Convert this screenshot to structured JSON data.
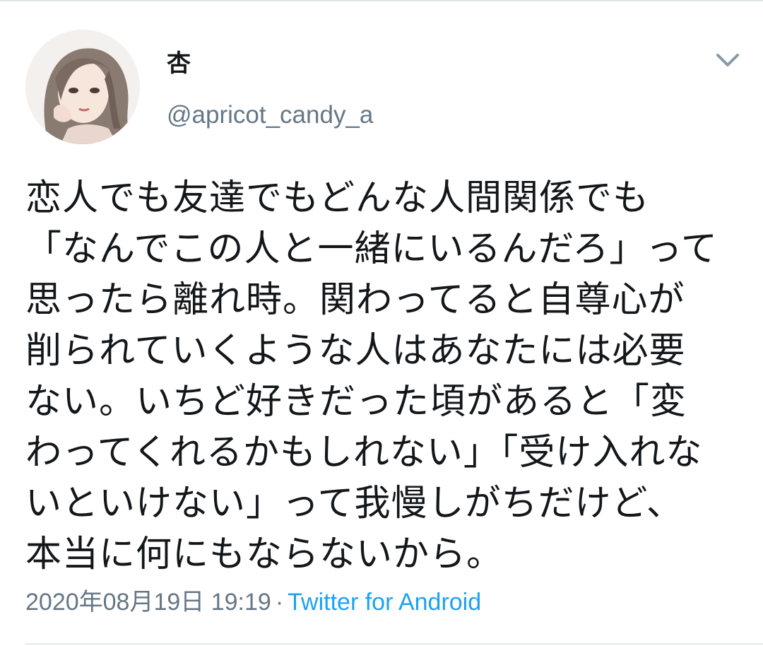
{
  "tweet": {
    "author": {
      "display_name": "杏",
      "handle": "@apricot_candy_a",
      "avatar_icon": "avatar-illustration"
    },
    "menu_icon": "chevron-down-icon",
    "text": "恋人でも友達でもどんな人間関係でも\n「なんでこの人と一緒にいるんだろ」って\n思ったら離れ時。関わってると自尊心が\n削られていくような人はあなたには必要\nない。いちど好きだった頃があると「変\nわってくれるかもしれない」「受け入れな\nいといけない」って我慢しがちだけど、\n本当に何にもならないから。",
    "timestamp": "2020年08月19日 19:19",
    "separator": "·",
    "source": "Twitter for Android"
  },
  "colors": {
    "text": "#14171a",
    "secondary": "#657786",
    "link": "#1da1f2",
    "divider": "#e1e8ed"
  }
}
